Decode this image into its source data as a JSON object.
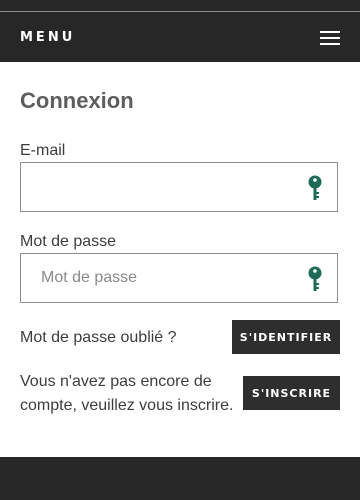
{
  "header": {
    "menu_label": "MENU"
  },
  "page": {
    "title": "Connexion"
  },
  "form": {
    "email_label": "E-mail",
    "email_value": "",
    "email_placeholder": "",
    "password_label": "Mot de passe",
    "password_value": "",
    "password_placeholder": "Mot de passe",
    "forgot_text": "Mot de passe oublié ?",
    "login_button": "S'IDENTIFIER",
    "signup_text_line1": "Vous n'avez pas encore de",
    "signup_text_line2": "compte, veuillez vous inscrire.",
    "signup_button": "S'INSCRIRE"
  },
  "colors": {
    "header_bg": "#272727",
    "button_bg": "#2e2e2e",
    "key_icon": "#1e6b57"
  },
  "icons": [
    "hamburger-menu-icon",
    "key-icon"
  ]
}
